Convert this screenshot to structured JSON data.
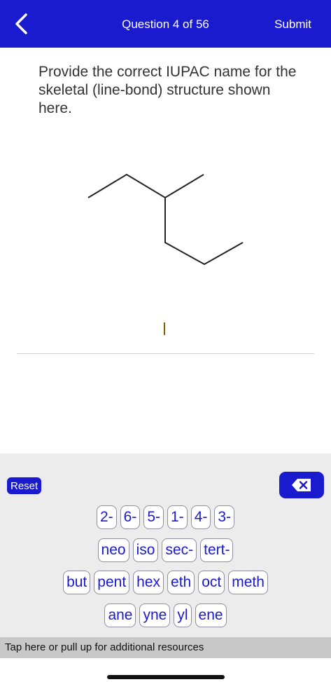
{
  "header": {
    "title": "Question 4 of 56",
    "submit_label": "Submit",
    "bg_color": "#1a1acf"
  },
  "question": {
    "prompt": "Provide the correct IUPAC name for the skeletal (line-bond) structure shown here."
  },
  "keyboard": {
    "reset_label": "Reset",
    "backspace_icon": "backspace-icon",
    "rows": [
      [
        "2-",
        "6-",
        "5-",
        "1-",
        "4-",
        "3-"
      ],
      [
        "neo",
        "iso",
        "sec-",
        "tert-"
      ],
      [
        "but",
        "pent",
        "hex",
        "eth",
        "oct",
        "meth"
      ],
      [
        "ane",
        "yne",
        "yl",
        "ene"
      ]
    ]
  },
  "footer": {
    "resources_text": "Tap here or pull up for additional resources"
  }
}
